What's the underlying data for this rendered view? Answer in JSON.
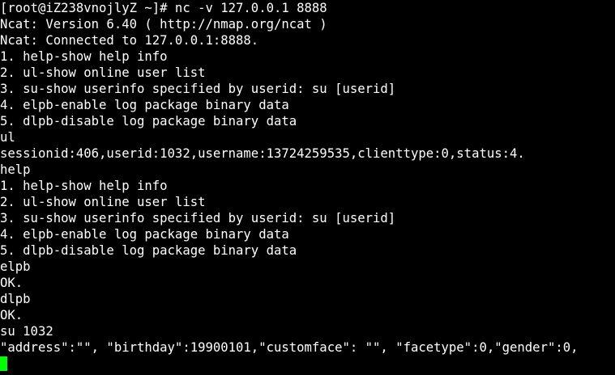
{
  "terminal": {
    "lines": [
      "[root@iZ238vnojlyZ ~]# nc -v 127.0.0.1 8888",
      "Ncat: Version 6.40 ( http://nmap.org/ncat )",
      "Ncat: Connected to 127.0.0.1:8888.",
      "1. help-show help info",
      "2. ul-show online user list",
      "3. su-show userinfo specified by userid: su [userid]",
      "4. elpb-enable log package binary data",
      "5. dlpb-disable log package binary data",
      "ul",
      "sessionid:406,userid:1032,username:13724259535,clienttype:0,status:4.",
      "help",
      "1. help-show help info",
      "2. ul-show online user list",
      "3. su-show userinfo specified by userid: su [userid]",
      "4. elpb-enable log package binary data",
      "5. dlpb-disable log package binary data",
      "elpb",
      "OK.",
      "dlpb",
      "OK.",
      "su 1032",
      "\"address\":\"\", \"birthday\":19900101,\"customface\": \"\", \"facetype\":0,\"gender\":0,"
    ],
    "colors": {
      "background": "#000000",
      "foreground": "#ffffff",
      "cursor": "#00ff00"
    }
  }
}
